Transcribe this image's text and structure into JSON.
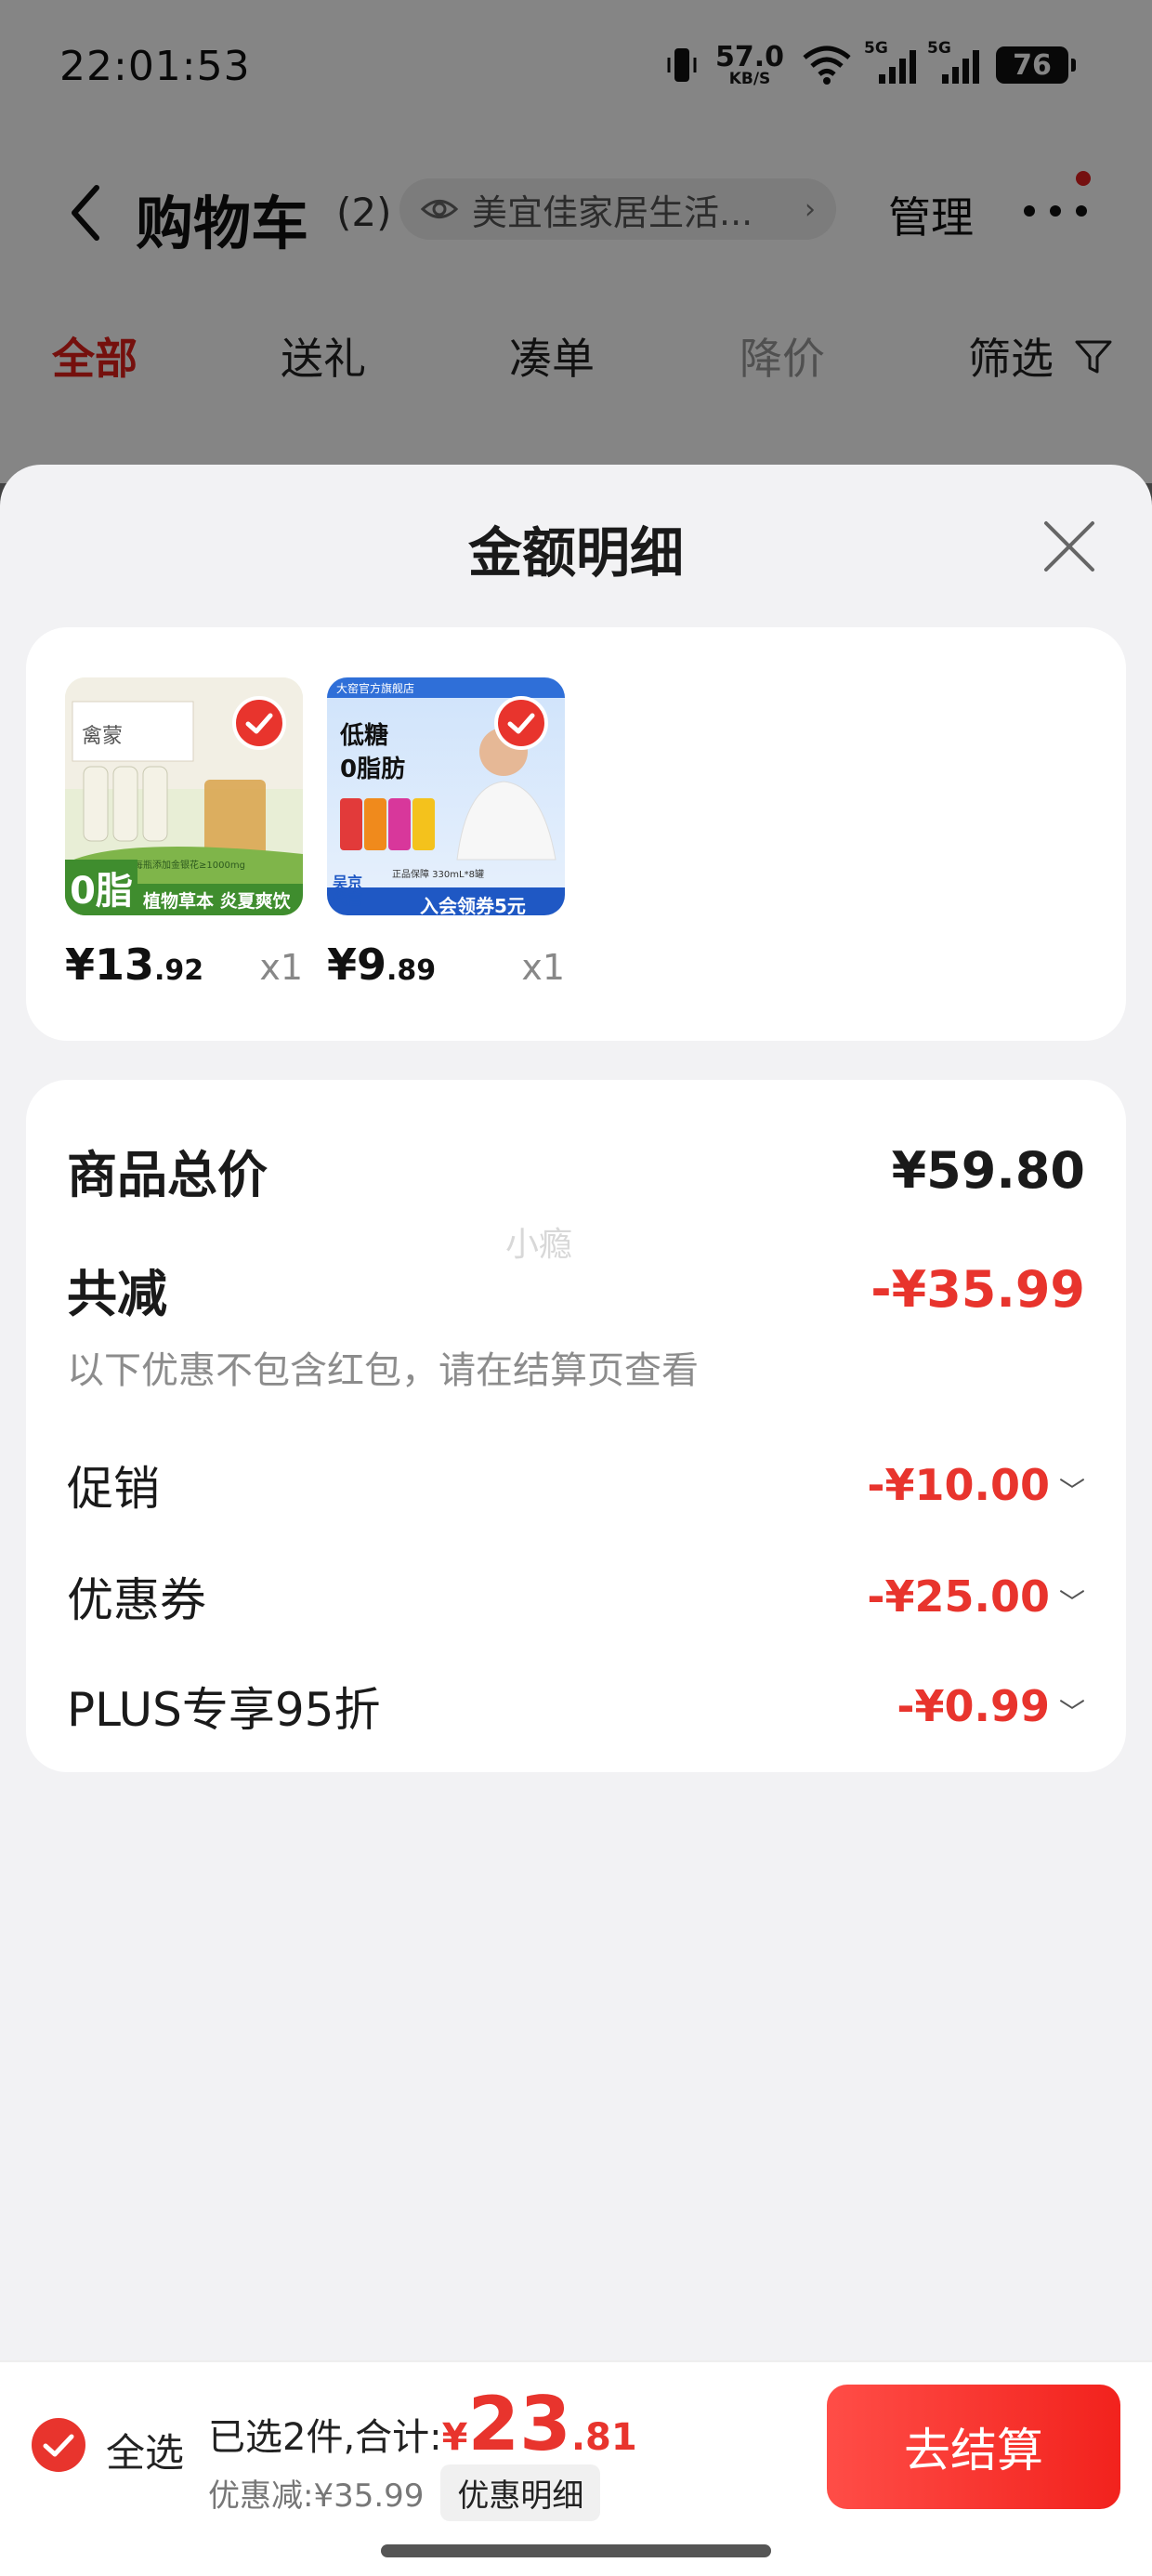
{
  "status_bar": {
    "time": "22:01:53",
    "net_speed": "57.0",
    "net_unit": "KB/S",
    "sig1": "5G",
    "sig2": "5G",
    "battery": "76"
  },
  "nav": {
    "title": "购物车",
    "count": "(2)",
    "store_name": "美宜佳家居生活...",
    "manage": "管理"
  },
  "filter_tabs": [
    "全部",
    "送礼",
    "凑单",
    "降价",
    "筛选"
  ],
  "sheet": {
    "title": "金额明细",
    "products": [
      {
        "price_int": "¥13",
        "price_dec": ".92",
        "qty": "x1",
        "thumb_badge": "0脂",
        "thumb_caption": "植物草本 炎夏爽饮",
        "thumb_brand": "禽蒙",
        "thumb_small": "每瓶添加金银花≥1000mg"
      },
      {
        "price_int": "¥9",
        "price_dec": ".89",
        "qty": "x1",
        "thumb_head": "大窑官方旗舰店",
        "thumb_t1": "低糖",
        "thumb_t2": "0脂肪",
        "thumb_vol": "正品保障 330mL*8罐",
        "thumb_tag": "吴京\n代言",
        "thumb_bottom": "入会领券5元"
      }
    ],
    "summary": {
      "total_label": "商品总价",
      "total_value": "¥59.80",
      "reduce_label": "共减",
      "reduce_value": "-¥35.99",
      "note": "以下优惠不包含红包，请在结算页查看",
      "watermark": "小瘾",
      "items": [
        {
          "label": "促销",
          "value": "-¥10.00"
        },
        {
          "label": "优惠券",
          "value": "-¥25.00"
        },
        {
          "label": "PLUS专享95折",
          "value": "-¥0.99"
        }
      ]
    }
  },
  "footer": {
    "select_all": "全选",
    "selected_text": "已选2件,合计:",
    "currency": "¥",
    "total_int": "23",
    "total_dec": ".81",
    "discount_text": "优惠减:¥35.99",
    "detail_btn": "优惠明细",
    "checkout": "去结算"
  },
  "colors": {
    "accent": "#e8342d",
    "tab_active": "#e0201a"
  }
}
